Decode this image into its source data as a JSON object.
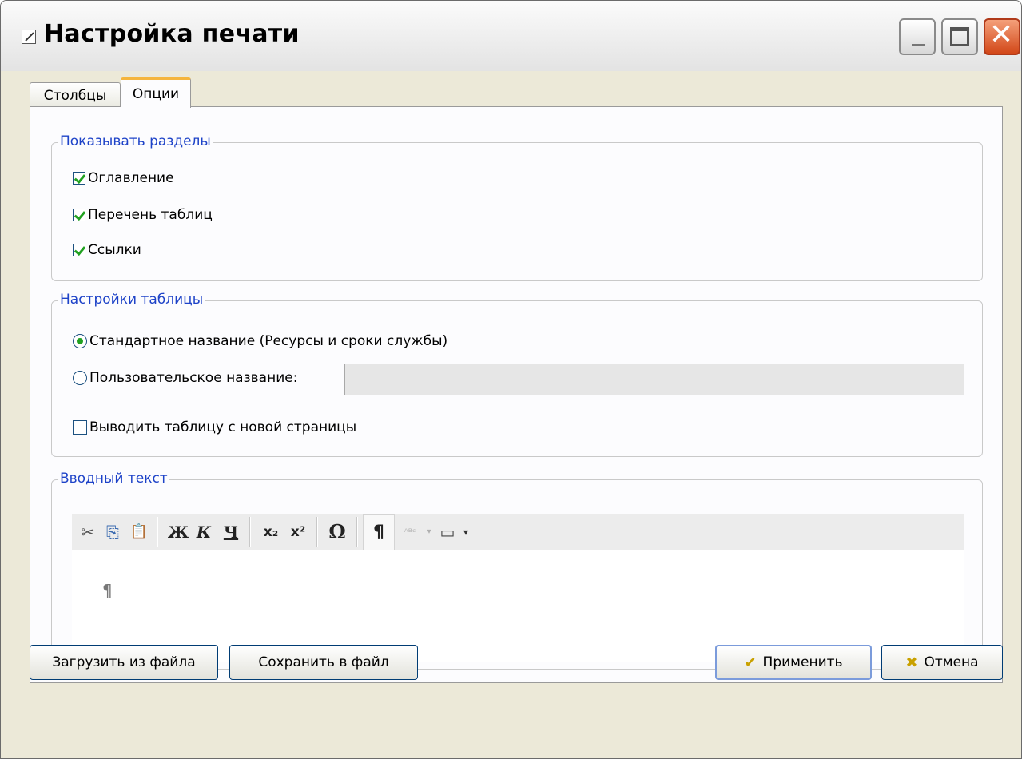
{
  "window": {
    "title": "Настройка печати",
    "controls": {
      "minimize": "_",
      "maximize": "□",
      "close": "✕"
    }
  },
  "tabs": [
    {
      "label": "Столбцы",
      "active": false
    },
    {
      "label": "Опции",
      "active": true
    }
  ],
  "show_sections": {
    "legend": "Показывать разделы",
    "items": [
      {
        "label": "Оглавление",
        "checked": true
      },
      {
        "label": "Перечень таблиц",
        "checked": true
      },
      {
        "label": "Ссылки",
        "checked": true
      }
    ]
  },
  "table_settings": {
    "legend": "Настройки таблицы",
    "standard_name": {
      "label": "Стандартное название (Ресурсы и сроки службы)",
      "selected": true
    },
    "custom_name": {
      "label": "Пользовательское название:",
      "selected": false,
      "value": ""
    },
    "new_page": {
      "label": "Выводить таблицу с новой страницы",
      "checked": false
    }
  },
  "intro_text": {
    "legend": "Вводный текст",
    "toolbar": [
      {
        "icon": "cut-icon",
        "glyph": "✂"
      },
      {
        "icon": "copy-icon",
        "glyph": "⎘"
      },
      {
        "icon": "paste-icon",
        "glyph": "📋"
      },
      {
        "icon": "bold-icon",
        "glyph": "Ж"
      },
      {
        "icon": "italic-icon",
        "glyph": "К"
      },
      {
        "icon": "underline-icon",
        "glyph": "Ч"
      },
      {
        "icon": "subscript-icon",
        "glyph": "x₂"
      },
      {
        "icon": "superscript-icon",
        "glyph": "x²"
      },
      {
        "icon": "special-character-icon",
        "glyph": "Ω"
      },
      {
        "icon": "show-formatting-marks-icon",
        "glyph": "¶"
      },
      {
        "icon": "spell-check-icon",
        "glyph": "ᴬᴮᶜ"
      },
      {
        "icon": "insert-field-icon",
        "glyph": "▭"
      }
    ],
    "content": "¶"
  },
  "buttons": {
    "load": "Загрузить из файла",
    "save": "Сохранить в файл",
    "apply": "Применить",
    "cancel": "Отмена"
  },
  "colors": {
    "group_legend": "#1e43c8",
    "check_mark": "#21a121",
    "active_tab_accent": "#f5b53c",
    "close_button": "#d24718"
  }
}
